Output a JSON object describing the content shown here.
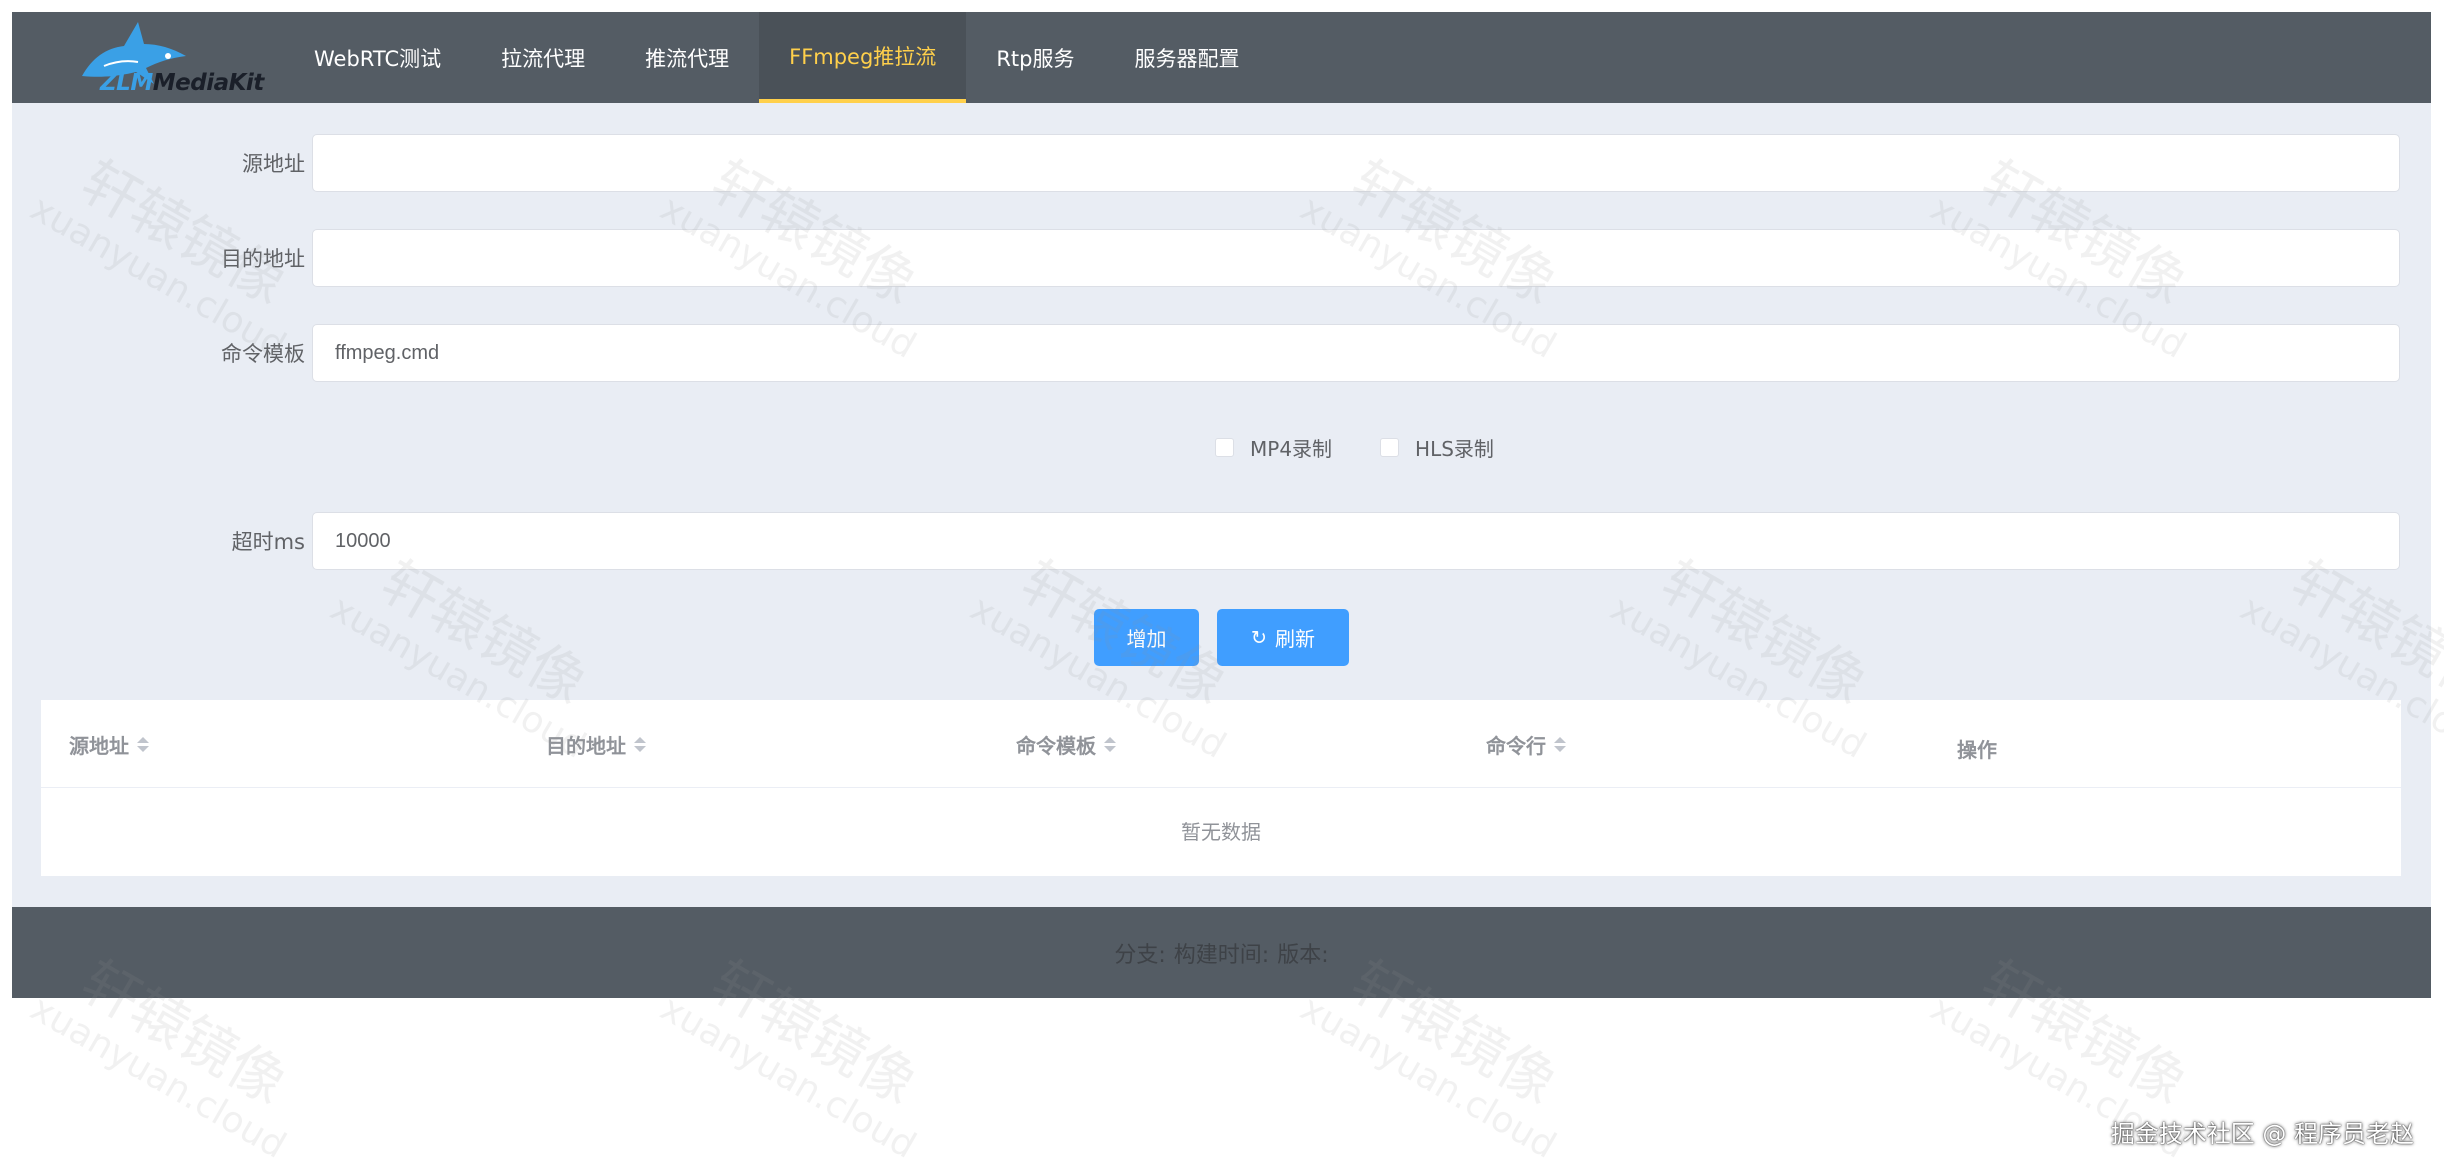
{
  "app": {
    "logo_text_accent": "ZLM",
    "logo_text_main": "ediaKit",
    "logo_letter": "M"
  },
  "nav": {
    "items": [
      {
        "label": "WebRTC测试",
        "active": false
      },
      {
        "label": "拉流代理",
        "active": false
      },
      {
        "label": "推流代理",
        "active": false
      },
      {
        "label": "FFmpeg推拉流",
        "active": true
      },
      {
        "label": "Rtp服务",
        "active": false
      },
      {
        "label": "服务器配置",
        "active": false
      }
    ]
  },
  "form": {
    "source_label": "源地址",
    "source_value": "",
    "dest_label": "目的地址",
    "dest_value": "",
    "cmd_label": "命令模板",
    "cmd_value": "ffmpeg.cmd",
    "mp4_label": "MP4录制",
    "mp4_checked": false,
    "hls_label": "HLS录制",
    "hls_checked": false,
    "timeout_label": "超时ms",
    "timeout_value": "10000",
    "add_label": "增加",
    "refresh_label": "刷新"
  },
  "table": {
    "columns": [
      "源地址",
      "目的地址",
      "命令模板",
      "命令行",
      "操作"
    ],
    "empty_text": "暂无数据"
  },
  "footer": {
    "branch_label": "分支:",
    "build_label": "构建时间:",
    "version_label": "版本:"
  },
  "watermark": {
    "text": "轩辕镜像",
    "sub": "xuanyuan.cloud"
  },
  "credit": "掘金技术社区 @ 程序员老赵",
  "colors": {
    "header_bg": "#545c64",
    "active_nav": "#ffd04b",
    "primary": "#409eff",
    "content_bg": "#e9edf4"
  }
}
